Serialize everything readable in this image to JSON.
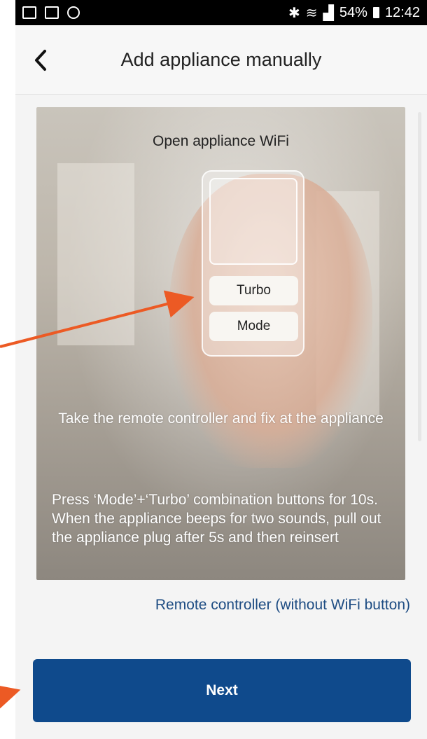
{
  "status_bar": {
    "battery": "54%",
    "time": "12:42",
    "left_icons": [
      "gallery-icon",
      "email-icon",
      "sync-icon"
    ],
    "right_icons": [
      "bluetooth-icon",
      "wifi-icon",
      "signal-icon",
      "battery-icon"
    ]
  },
  "header": {
    "title": "Add appliance manually",
    "back_icon": "chevron-left-icon"
  },
  "card": {
    "title": "Open appliance WiFi",
    "remote_buttons": [
      "Turbo",
      "Mode"
    ],
    "instruction_1": "Take the remote controller and fix at the appliance",
    "instruction_2": "Press ‘Mode’+‘Turbo’ combination buttons for 10s. When the appliance beeps for two sounds, pull out the appliance plug after 5s and then reinsert"
  },
  "remote_link": "Remote controller (without WiFi button)",
  "next_button": "Next",
  "colors": {
    "accent": "#0f4a8c",
    "link": "#1c4b82",
    "annotation_arrow": "#ec5a24"
  }
}
